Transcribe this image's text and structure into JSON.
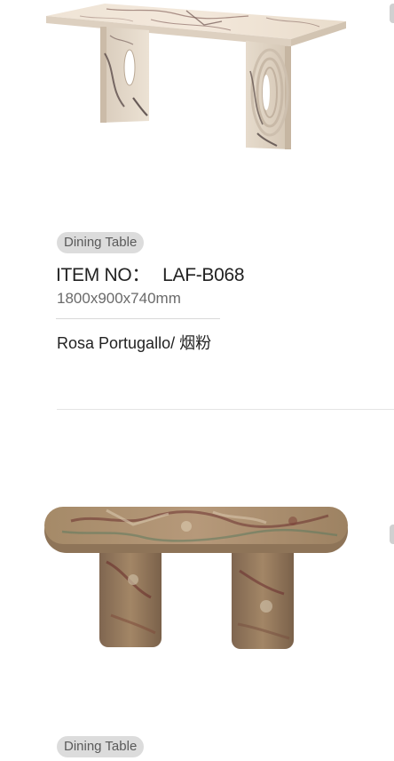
{
  "products": [
    {
      "category": "Dining Table",
      "item_label": "ITEM NO：",
      "item_code": "LAF-B068",
      "dimensions": "1800x900x740mm",
      "material": "Rosa Portugallo/ 烟粉"
    },
    {
      "category": "Dining Table"
    }
  ],
  "colors": {
    "badge_bg": "#dcdcdc",
    "badge_text": "#5a5a5a",
    "title_text": "#222222",
    "dimension_text": "#6a6a6a",
    "rule": "#d8d8d8"
  }
}
